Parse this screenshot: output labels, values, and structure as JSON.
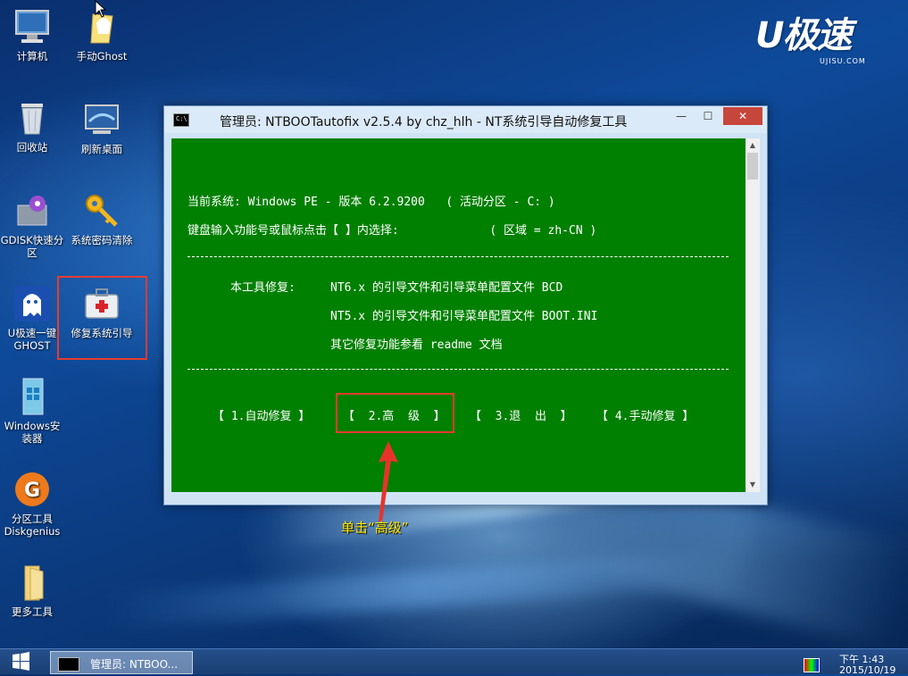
{
  "desktop": {
    "icons": [
      {
        "label": "计算机"
      },
      {
        "label": "手动Ghost"
      },
      {
        "label": "回收站"
      },
      {
        "label": "刷新桌面"
      },
      {
        "label": "GDISK快速分区"
      },
      {
        "label": "系统密码清除"
      },
      {
        "label": "U极速一键GHOST"
      },
      {
        "label": "修复系统引导"
      },
      {
        "label": "Windows安装器"
      },
      {
        "label": "分区工具Diskgenius"
      },
      {
        "label": "更多工具"
      }
    ]
  },
  "logo": {
    "brand": "U极速",
    "site": "UJISU.COM"
  },
  "window": {
    "title": "管理员:  NTBOOTautofix v2.5.4 by chz_hlh - NT系统引导自动修复工具",
    "min_symbol": "—",
    "max_symbol": "☐",
    "close_symbol": "✕",
    "console": {
      "line1": "当前系统: Windows PE - 版本 6.2.9200   ( 活动分区 - C: )",
      "line2": "键盘输入功能号或鼠标点击【 】内选择:             ( 区域 = zh-CN )",
      "repair_label": "本工具修复:",
      "repair1": "NT6.x 的引导文件和引导菜单配置文件 BCD",
      "repair2": "NT5.x 的引导文件和引导菜单配置文件 BOOT.INI",
      "repair3": "其它修复功能参看 readme 文档",
      "options": [
        "【 1.自动修复 】",
        "【  2.高  级  】",
        "【  3.退  出  】",
        "【 4.手动修复 】"
      ]
    }
  },
  "annotation": {
    "text": "单击“高级”"
  },
  "taskbar": {
    "task_label": "管理员: NTBOO...",
    "clock_time": "下午 1:43",
    "clock_date": "2015/10/19"
  }
}
